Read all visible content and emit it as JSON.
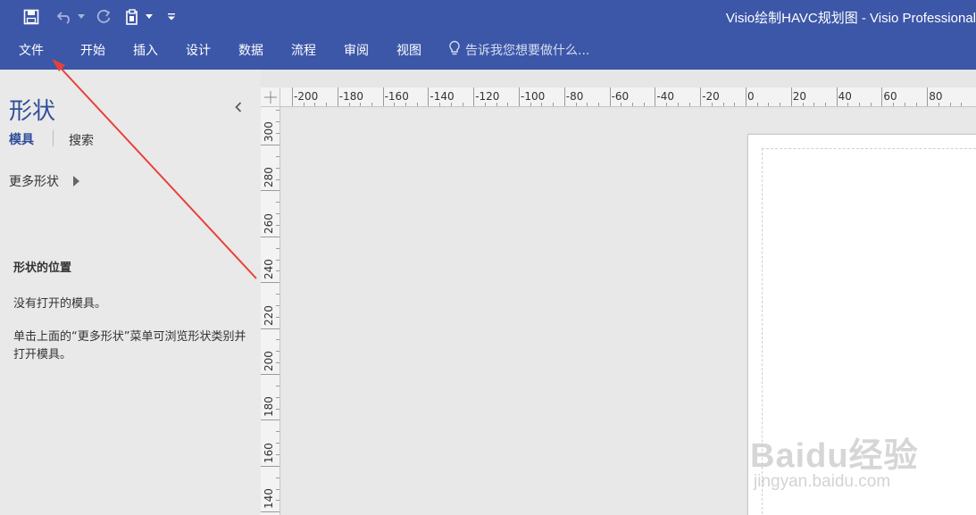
{
  "window": {
    "title": "Visio绘制HAVC规划图 - Visio Professional"
  },
  "quick_access": {
    "icons": [
      "save-icon",
      "undo-icon",
      "undo-dropdown-icon",
      "redo-icon",
      "page-icon",
      "page-dropdown-icon",
      "customize-qat-icon"
    ]
  },
  "ribbon": {
    "tabs": [
      "文件",
      "开始",
      "插入",
      "设计",
      "数据",
      "流程",
      "审阅",
      "视图"
    ],
    "tell_me": "告诉我您想要做什么..."
  },
  "shapes_pane": {
    "title": "形状",
    "tab_stencils": "模具",
    "tab_search": "搜索",
    "more_shapes": "更多形状",
    "location_heading": "形状的位置",
    "no_stencils": "没有打开的模具。",
    "help_text": "单击上面的“更多形状”菜单可浏览形状类别并打开模具。"
  },
  "ruler": {
    "horizontal": [
      "-200",
      "-180",
      "-160",
      "-140",
      "-120",
      "-100",
      "-80",
      "-60",
      "-40",
      "-20",
      "0",
      "20",
      "40",
      "60",
      "80"
    ],
    "vertical": [
      "300",
      "280",
      "260",
      "240",
      "220",
      "200",
      "180",
      "160",
      "140"
    ]
  },
  "annotation": {
    "color": "#e8403c"
  },
  "watermark": {
    "logo": "Baidu经验",
    "url": "jingyan.baidu.com"
  },
  "colors": {
    "ribbon": "#3c57a8",
    "accent": "#2f4e9a"
  }
}
